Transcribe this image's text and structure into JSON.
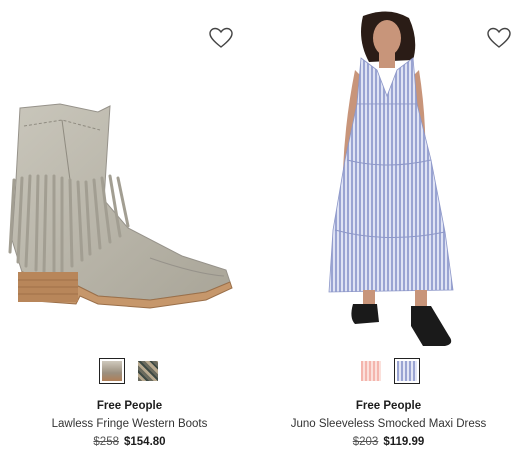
{
  "products": [
    {
      "brand": "Free People",
      "name": "Lawless Fringe Western Boots",
      "original_price": "$258",
      "sale_price": "$154.80",
      "image_icon": "fringe-boot-image",
      "swatches": [
        {
          "name": "taupe-suede",
          "color": "#9a9082",
          "selected": true
        },
        {
          "name": "snake-print",
          "color": "#7a7a6a",
          "selected": false
        }
      ]
    },
    {
      "brand": "Free People",
      "name": "Juno Sleeveless Smocked Maxi Dress",
      "original_price": "$203",
      "sale_price": "$119.99",
      "image_icon": "maxi-dress-image",
      "swatches": [
        {
          "name": "pink-stripe",
          "color": "#f2b9b2",
          "selected": false
        },
        {
          "name": "blue-stripe",
          "color": "#a9b3d9",
          "selected": true
        }
      ]
    }
  ],
  "icons": {
    "wishlist": "heart-outline-icon"
  }
}
